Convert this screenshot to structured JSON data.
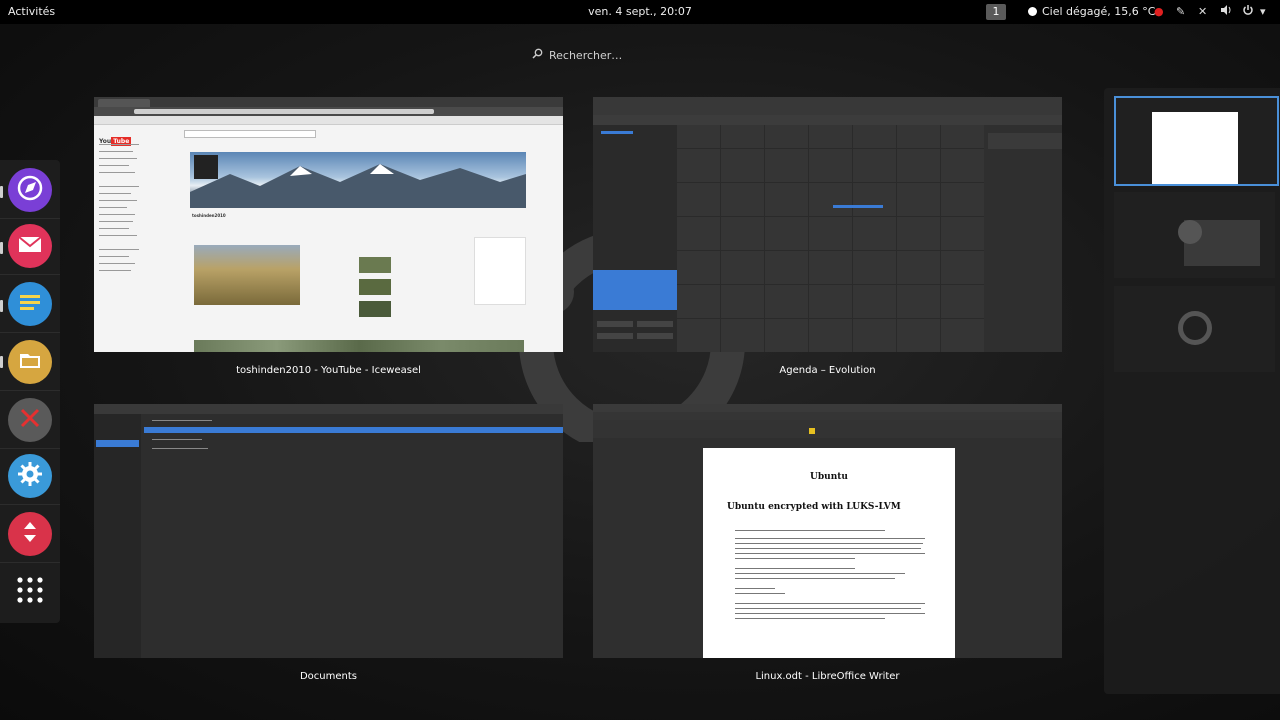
{
  "topbar": {
    "activities": "Activités",
    "clock": "ven.  4 sept., 20:07",
    "workspace_number": "1",
    "weather": "Ciel dégagé, 15,6 °C"
  },
  "search": {
    "placeholder": "Rechercher…"
  },
  "dash": {
    "apps": [
      {
        "name": "Iceweasel",
        "icon": "compass-icon",
        "color": "#7a3fd6"
      },
      {
        "name": "Evolution",
        "icon": "mail-icon",
        "color": "#e0335a"
      },
      {
        "name": "Notes",
        "icon": "notes-icon",
        "color": "#2f8fd8"
      },
      {
        "name": "Documents",
        "icon": "folder-icon",
        "color": "#d6a640"
      },
      {
        "name": "Tools",
        "icon": "tools-icon",
        "color": "#5a5a5a"
      },
      {
        "name": "Settings",
        "icon": "gear-icon",
        "color": "#3a9ad9"
      },
      {
        "name": "Transfer",
        "icon": "transfer-icon",
        "color": "#d9334a"
      },
      {
        "name": "Show Applications",
        "icon": "app-grid-icon",
        "color": "#2a2a2a"
      }
    ]
  },
  "windows": [
    {
      "title": "toshinden2010 - YouTube - Iceweasel"
    },
    {
      "title": "Agenda – Evolution"
    },
    {
      "title": "Documents"
    },
    {
      "title": "Linux.odt - LibreOffice Writer"
    }
  ],
  "youtube": {
    "channel": "toshinden2010",
    "logo_text": "You Tube"
  },
  "writer": {
    "doc_title": "Ubuntu",
    "doc_heading": "Ubuntu encrypted with LUKS-LVM"
  }
}
